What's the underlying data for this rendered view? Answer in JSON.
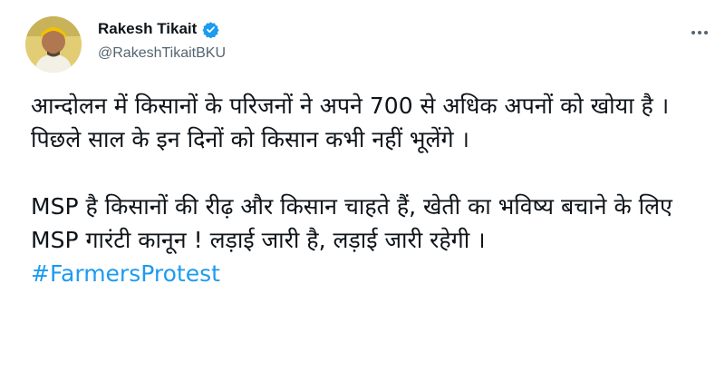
{
  "tweet": {
    "author_name": "Rakesh Tikait",
    "author_handle": "@RakeshTikaitBKU",
    "verified_color": "#1d9bf0",
    "hashtag_color": "#1d9bf0",
    "paragraph1": "आन्दोलन में किसानों के परिजनों ने अपने 700 से अधिक अपनों को खोया है । पिछले साल के इन दिनों को किसान कभी नहीं भूलेंगे ।",
    "paragraph2": "MSP है किसानों की रीढ़ और किसान चाहते हैं, खेती का भविष्य बचाने के लिए MSP गारंटी कानून ! लड़ाई जारी है, लड़ाई जारी रहेगी ।",
    "hashtag": "#FarmersProtest",
    "more_icon": "more-horizontal-icon",
    "verified_icon": "verified-badge-icon"
  }
}
